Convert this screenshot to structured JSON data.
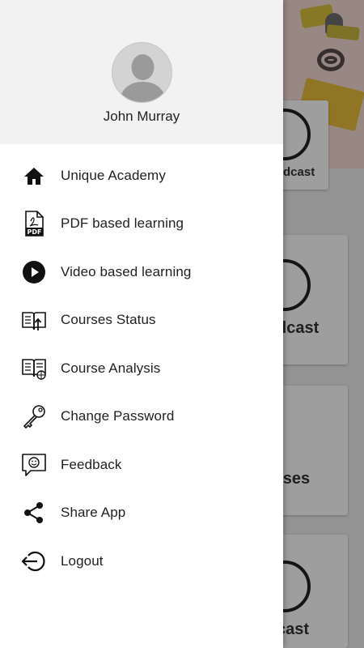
{
  "drawer": {
    "user": {
      "name": "John Murray"
    },
    "items": [
      {
        "label": "Unique Academy",
        "icon": "home-icon"
      },
      {
        "label": "PDF based learning",
        "icon": "pdf-icon"
      },
      {
        "label": "Video based learning",
        "icon": "play-circle-icon"
      },
      {
        "label": "Courses Status",
        "icon": "book-upload-icon"
      },
      {
        "label": "Course Analysis",
        "icon": "book-globe-icon"
      },
      {
        "label": "Change Password",
        "icon": "key-icon"
      },
      {
        "label": "Feedback",
        "icon": "feedback-smile-icon"
      },
      {
        "label": "Share App",
        "icon": "share-icon"
      },
      {
        "label": "Logout",
        "icon": "logout-icon"
      }
    ]
  },
  "background": {
    "cards": [
      "dcast",
      "dcast",
      "rses",
      "cast"
    ]
  },
  "colors": {
    "drawer_bg": "#ffffff",
    "header_bg": "#f2f2f2",
    "text": "#1f1f1f",
    "icon": "#111111"
  }
}
